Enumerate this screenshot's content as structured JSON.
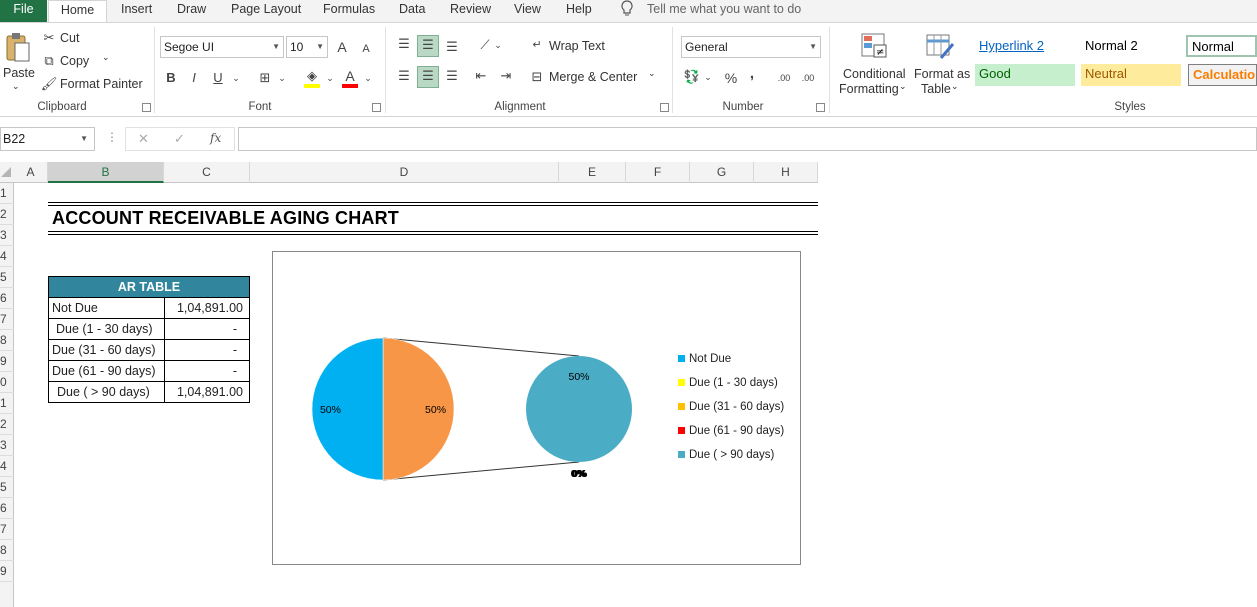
{
  "tabs": [
    "File",
    "Home",
    "Insert",
    "Draw",
    "Page Layout",
    "Formulas",
    "Data",
    "Review",
    "View",
    "Help"
  ],
  "tell_me": "Tell me what you want to do",
  "clipboard": {
    "paste": "Paste",
    "cut": "Cut",
    "copy": "Copy",
    "format_painter": "Format Painter",
    "label": "Clipboard"
  },
  "font": {
    "name": "Segoe UI",
    "size": "10",
    "bold": "B",
    "italic": "I",
    "underline": "U",
    "label": "Font",
    "grow": "A",
    "shrink": "A",
    "font_color": "A"
  },
  "alignment": {
    "wrap_text": "Wrap Text",
    "merge_center": "Merge & Center",
    "label": "Alignment"
  },
  "number": {
    "format": "General",
    "percent": "%",
    "comma": ",",
    "inc_dec": ".00",
    "dec_dec": ".00",
    "label": "Number"
  },
  "styles_group": {
    "conditional_1": "Conditional",
    "conditional_2": "Formatting",
    "format_table_1": "Format as",
    "format_table_2": "Table",
    "hyperlink2": "Hyperlink 2",
    "normal2": "Normal 2",
    "normal": "Normal",
    "good": "Good",
    "neutral": "Neutral",
    "calculation": "Calculation",
    "label": "Styles"
  },
  "formula_bar": {
    "name_box": "B22",
    "fx": "fx",
    "value": ""
  },
  "columns": [
    "A",
    "B",
    "C",
    "D",
    "E",
    "F",
    "G",
    "H"
  ],
  "rows": [
    "1",
    "2",
    "3",
    "4",
    "5",
    "6",
    "7",
    "8",
    "9",
    "0",
    "1",
    "2",
    "3",
    "4",
    "5",
    "6",
    "7",
    "8",
    "9"
  ],
  "sheet": {
    "title": "ACCOUNT RECEIVABLE AGING CHART"
  },
  "ar_table": {
    "header": "AR TABLE",
    "rows": [
      {
        "label": "Not Due",
        "value": "1,04,891.00"
      },
      {
        "label": "Due (1 - 30 days)",
        "value": "-"
      },
      {
        "label": "Due (31 - 60 days)",
        "value": "-"
      },
      {
        "label": "Due (61 - 90 days)",
        "value": "-"
      },
      {
        "label": "Due ( > 90 days)",
        "value": "1,04,891.00"
      }
    ]
  },
  "chart_data": {
    "type": "pie",
    "subtype": "pie-of-pie",
    "categories": [
      "Not Due",
      "Due (1 - 30 days)",
      "Due (31 - 60 days)",
      "Due (61 - 90 days)",
      "Due ( > 90 days)"
    ],
    "values": [
      104891.0,
      0,
      0,
      0,
      104891.0
    ],
    "colors": [
      "#00b0f0",
      "#ffff00",
      "#ffc000",
      "#ff0000",
      "#4bacc6"
    ],
    "primary_slices": [
      {
        "label": "50%",
        "value": 50,
        "color": "#00b0f0"
      },
      {
        "label": "50%",
        "value": 50,
        "color": "#f79646"
      }
    ],
    "secondary_slices": [
      {
        "label": "50%",
        "value": 50,
        "color": "#4bacc6"
      }
    ],
    "zero_labels": "0%",
    "legend_position": "right"
  }
}
